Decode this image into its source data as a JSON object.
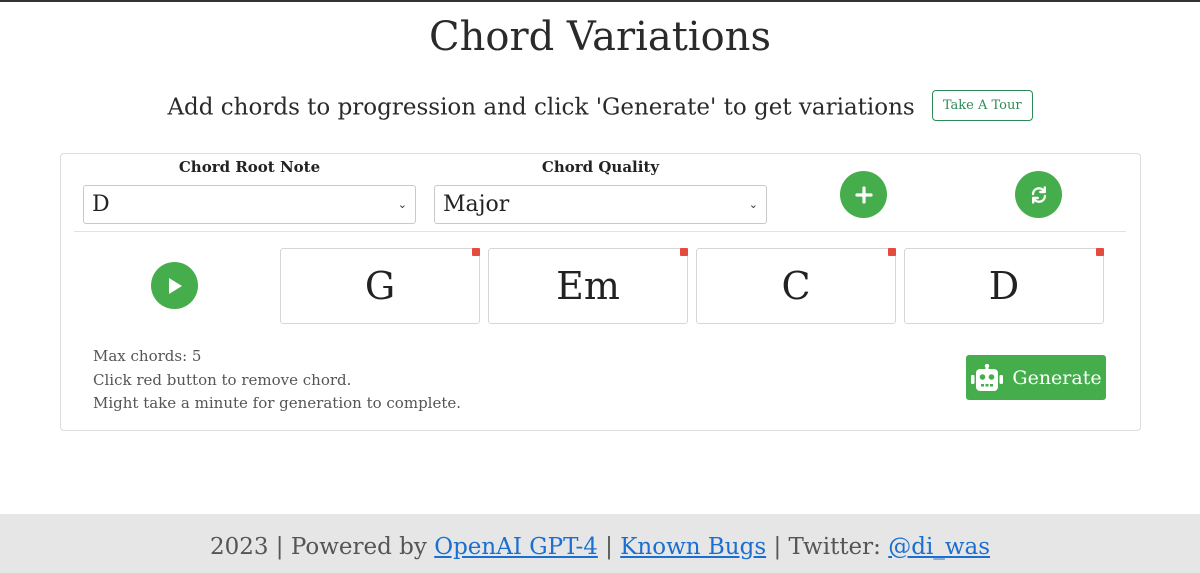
{
  "header": {
    "title": "Chord Variations",
    "subtitle": "Add chords to progression and click 'Generate' to get variations",
    "tour_button": "Take A Tour"
  },
  "controls": {
    "root_label": "Chord Root Note",
    "root_value": "D",
    "quality_label": "Chord Quality",
    "quality_value": "Major",
    "add_icon": "plus-icon",
    "refresh_icon": "refresh-icon",
    "play_icon": "play-icon"
  },
  "chords": [
    {
      "name": "G"
    },
    {
      "name": "Em"
    },
    {
      "name": "C"
    },
    {
      "name": "D"
    }
  ],
  "notes": {
    "max": "Max chords: 5",
    "remove_hint": "Click red button to remove chord.",
    "wait_hint": "Might take a minute for generation to complete."
  },
  "generate": {
    "label": "Generate",
    "icon": "robot-icon"
  },
  "footer": {
    "prefix": "2023 | Powered by ",
    "link_openai": "OpenAI GPT-4",
    "sep1": " | ",
    "link_bugs": "Known Bugs",
    "sep2": " | Twitter: ",
    "link_twitter": "@di_was"
  },
  "colors": {
    "accent_green": "#45ad4c",
    "remove_red": "#e34b3c",
    "link_blue": "#1a6fd1"
  }
}
